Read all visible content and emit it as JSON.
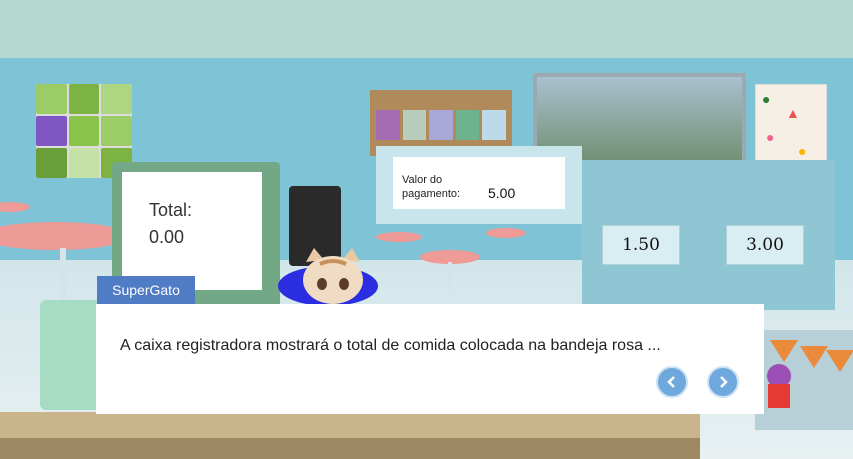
{
  "register": {
    "total_label": "Total:",
    "total_value": "0.00"
  },
  "payment": {
    "label": "Valor do pagamento:",
    "value": "5.00"
  },
  "price_tags": [
    "1.50",
    "3.00"
  ],
  "dialog": {
    "speaker": "SuperGato",
    "text": "A caixa registradora mostrará o total de comida colocada na bandeja rosa ...",
    "prev_icon": "chevron-left-icon",
    "next_icon": "chevron-right-icon"
  },
  "colors": {
    "speaker_bg": "#4f7cc4",
    "nav_button": "#6fa8dc"
  }
}
